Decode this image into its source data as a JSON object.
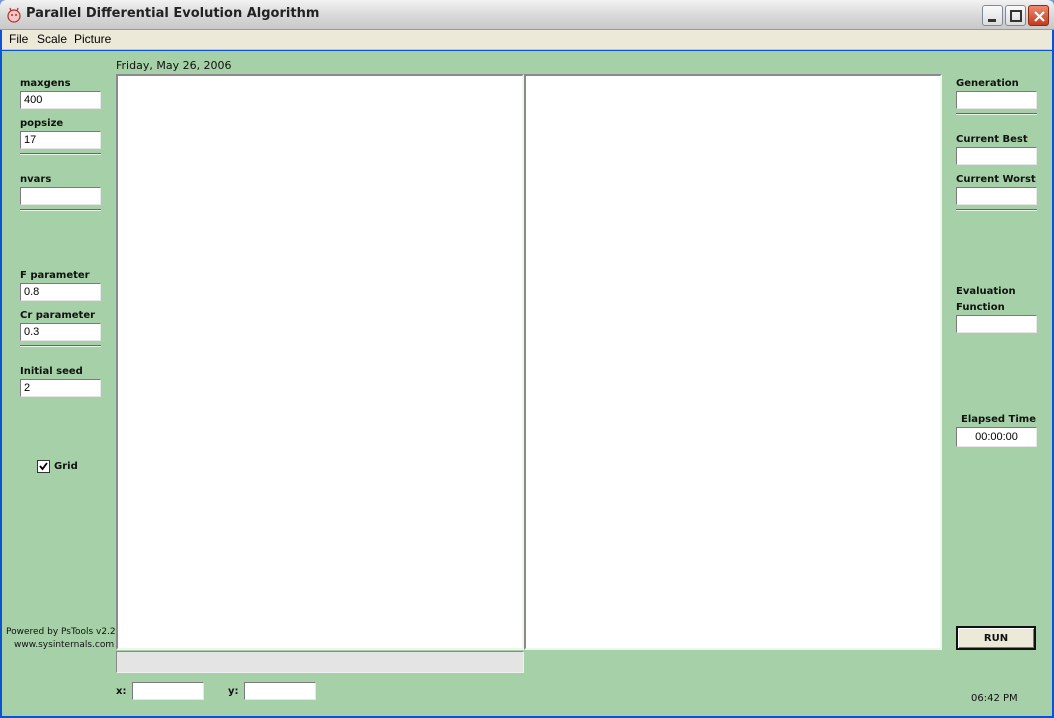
{
  "window": {
    "title": "Parallel Differential Evolution Algorithm"
  },
  "menu": [
    "File",
    "Scale",
    "Picture"
  ],
  "date_label": "Friday, May 26, 2006",
  "left_panel": {
    "maxgens": {
      "label": "maxgens",
      "value": "400"
    },
    "popsize": {
      "label": "popsize",
      "value": "17"
    },
    "nvars": {
      "label": "nvars",
      "value": ""
    },
    "f_param": {
      "label": "F parameter",
      "value": "0.8"
    },
    "cr_param": {
      "label": "Cr parameter",
      "value": "0.3"
    },
    "seed": {
      "label": "Initial seed",
      "value": "2"
    },
    "grid": {
      "label": "Grid",
      "checked": true
    },
    "powered_by": "Powered by PsTools v2.2",
    "website": "www.sysinternals.com"
  },
  "right_panel": {
    "generation": {
      "label": "Generation",
      "value": ""
    },
    "current_best": {
      "label": "Current Best",
      "value": ""
    },
    "current_worst": {
      "label": "Current Worst",
      "value": ""
    },
    "eval_label_1": "Evaluation",
    "eval_label_2": "Function",
    "eval_value": "",
    "elapsed_label": "Elapsed Time",
    "elapsed_value": "00:00:00",
    "run_label": "RUN",
    "clock": "06:42 PM"
  },
  "coords": {
    "x_label": "x:",
    "x_value": "",
    "y_label": "y:",
    "y_value": ""
  },
  "colors": {
    "client_background": "#a6d1a8"
  }
}
